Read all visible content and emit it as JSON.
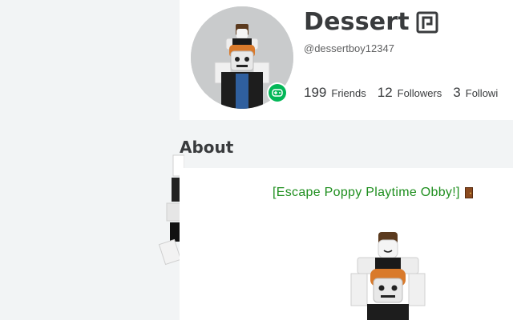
{
  "profile": {
    "display_name": "Dessert",
    "username": "@dessertboy12347",
    "premium_icon": "premium-icon",
    "presence_icon": "gamepad-icon",
    "presence_color": "#02b757",
    "stats": [
      {
        "value": "199",
        "label": "Friends"
      },
      {
        "value": "12",
        "label": "Followers"
      },
      {
        "value": "3",
        "label": "Followi"
      }
    ]
  },
  "about": {
    "heading": "About",
    "text": "[Escape Poppy Playtime Obby!]",
    "text_color": "#1f8f1f",
    "emoji_icon": "door-icon"
  }
}
